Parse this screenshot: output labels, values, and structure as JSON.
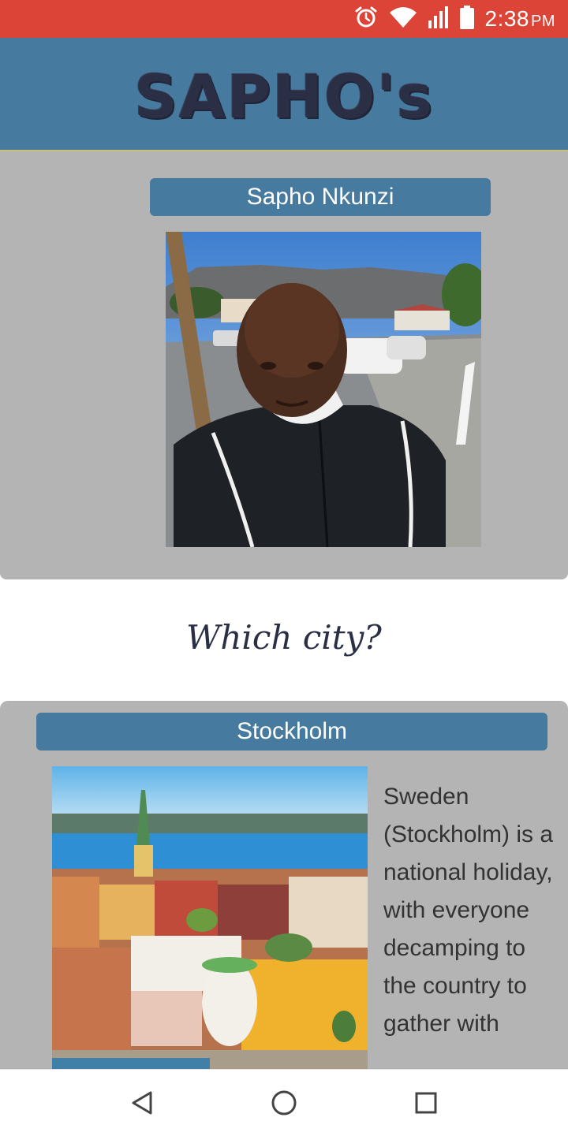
{
  "status_bar": {
    "time": "2:38",
    "ampm": "PM",
    "background": "#dc4437",
    "icons": [
      "alarm-icon",
      "wifi-icon",
      "signal-icon",
      "battery-icon"
    ]
  },
  "header": {
    "brand": "SAPHO's",
    "background": "#467a9e"
  },
  "profile": {
    "name": "Sapho Nkunzi"
  },
  "section": {
    "heading": "Which city?"
  },
  "city": {
    "name": "Stockholm",
    "description": "Sweden (Stockholm) is a national holiday, with everyone decamping to the country to gather with"
  },
  "nav": {
    "icons": [
      "back-icon",
      "home-icon",
      "recents-icon"
    ]
  }
}
